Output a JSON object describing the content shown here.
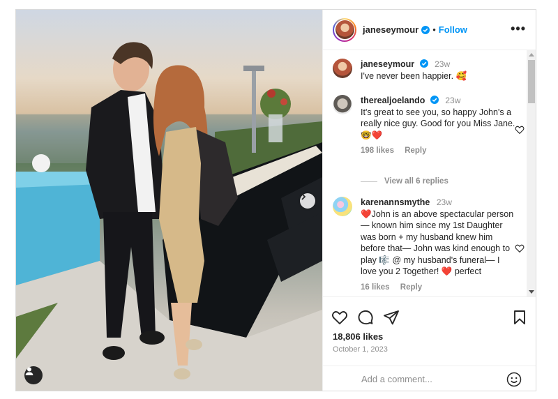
{
  "post": {
    "author": "janeseymour",
    "follow_label": "Follow",
    "separator": "•",
    "more_label": "•••"
  },
  "comments": [
    {
      "user": "janeseymour",
      "time": "23w",
      "text": "I've never been happier. 🥰",
      "verified": true
    },
    {
      "user": "therealjoelando",
      "time": "23w",
      "text": "It's great to see you, so happy John's a really nice guy. Good for you Miss Jane.🤓❤️",
      "verified": true,
      "likes": "198 likes",
      "reply_label": "Reply",
      "view_replies": "View all 6 replies"
    },
    {
      "user": "karenannsmythe",
      "time": "23w",
      "text": "❤️John is an above spectacular person— known him since my 1st Daughter was born + my husband knew him before that— John was kind enough to play 🎼 @ my husband's funeral— I love you 2 Together! ❤️ perfect",
      "verified": false,
      "likes": "16 likes",
      "reply_label": "Reply"
    }
  ],
  "actions": {
    "likes": "18,806 likes",
    "date": "October 1, 2023"
  },
  "composer": {
    "placeholder": "Add a comment..."
  },
  "icons": {
    "like": "heart-icon",
    "comment": "comment-icon",
    "share": "share-icon",
    "save": "bookmark-icon",
    "emoji": "emoji-icon",
    "more": "more-options-icon",
    "next": "chevron-right-icon",
    "user_tag": "user-tag-icon",
    "verified": "verified-badge-icon"
  },
  "colors": {
    "link_blue": "#0095f6",
    "verified_blue": "#0095f6",
    "muted": "#8e8e8e",
    "text": "#262626"
  }
}
